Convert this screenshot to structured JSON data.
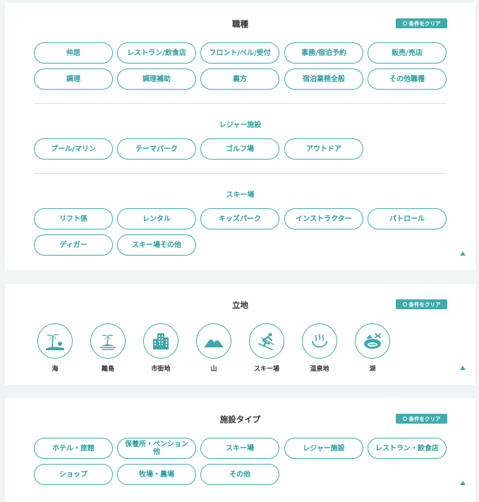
{
  "colors": {
    "accent": "#3ea8aa",
    "text": "#333333",
    "background": "#f0f4f4"
  },
  "job": {
    "title": "職種",
    "clear_label": "条件をクリア",
    "main_items": [
      "仲居",
      "レストラン/飲食店",
      "フロント/ベル/受付",
      "事務/宿泊予約",
      "販売/売店",
      "調理",
      "調理補助",
      "裏方",
      "宿泊業務全般",
      "その他職種"
    ],
    "leisure_title": "レジャー施設",
    "leisure_items": [
      "プール/マリン",
      "テーマパーク",
      "ゴルフ場",
      "アウトドア"
    ],
    "ski_title": "スキー場",
    "ski_items": [
      "リフト係",
      "レンタル",
      "キッズパーク",
      "インストラクター",
      "パトロール",
      "ディガー",
      "スキー場その他"
    ]
  },
  "location": {
    "title": "立地",
    "clear_label": "条件をクリア",
    "items": [
      {
        "label": "海",
        "icon": "beach-icon"
      },
      {
        "label": "離島",
        "icon": "island-icon"
      },
      {
        "label": "市街地",
        "icon": "city-building-icon"
      },
      {
        "label": "山",
        "icon": "mountain-icon"
      },
      {
        "label": "スキー場",
        "icon": "skier-icon"
      },
      {
        "label": "温泉地",
        "icon": "hot-spring-icon"
      },
      {
        "label": "湖",
        "icon": "lake-icon"
      }
    ]
  },
  "facility": {
    "title": "施設タイプ",
    "clear_label": "条件をクリア",
    "items": [
      "ホテル・旅館",
      "保養所・ペンション他",
      "スキー場",
      "レジャー施設",
      "レストラン・飲食店",
      "ショップ",
      "牧場・農場",
      "その他"
    ]
  }
}
